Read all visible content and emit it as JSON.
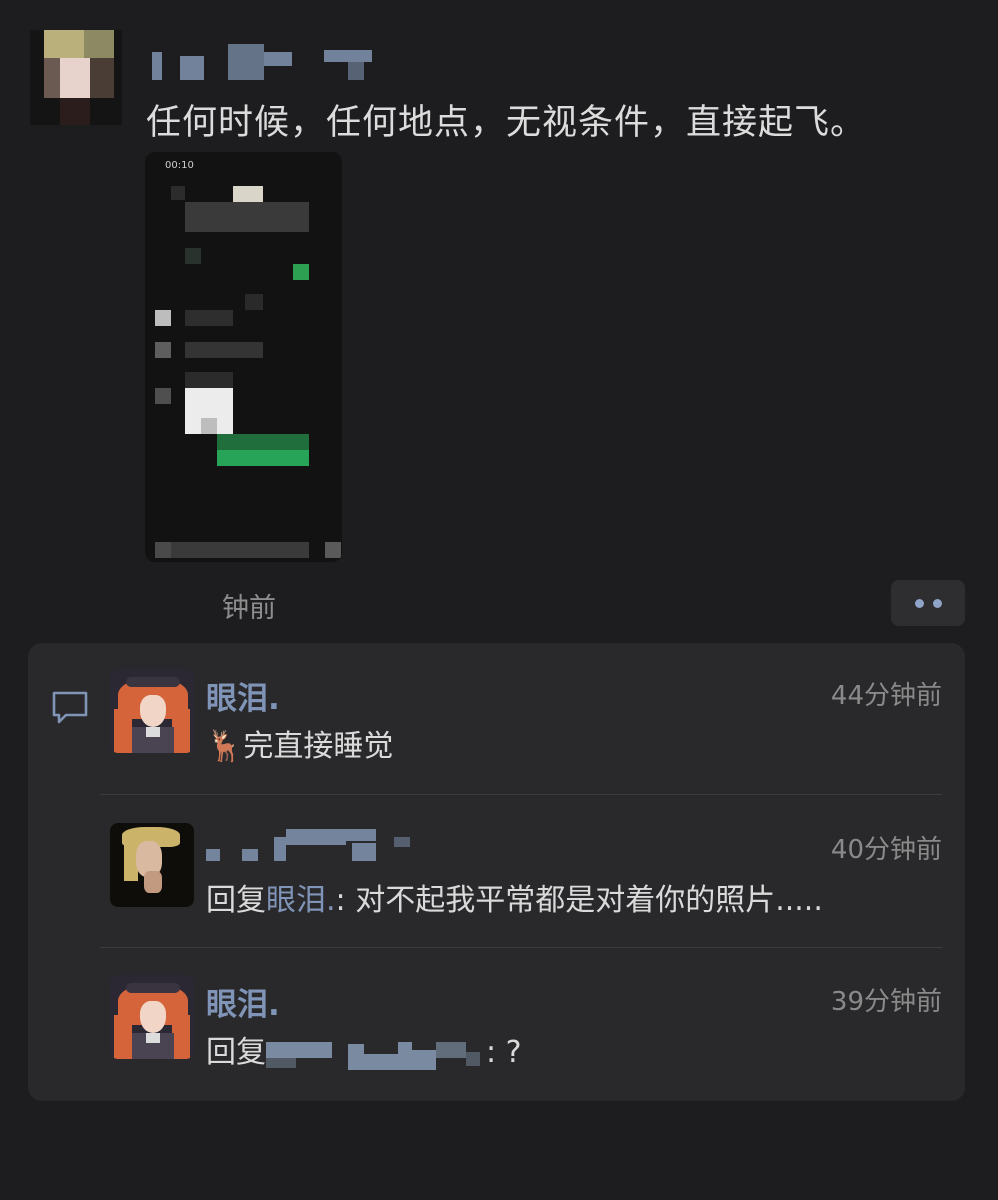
{
  "post": {
    "text": "任何时候，任何地点，无视条件，直接起飞。",
    "image_status_time": "00:10",
    "time_ago": "钟前"
  },
  "comments": [
    {
      "name": "眼泪.",
      "time": "44分钟前",
      "emoji": "🦌",
      "text": "完直接睡觉"
    },
    {
      "time": "40分钟前",
      "reply_prefix": "回复",
      "reply_to": "眼泪.",
      "text": ": 对不起我平常都是对着你的照片....."
    },
    {
      "name": "眼泪.",
      "time": "39分钟前",
      "reply_prefix": "回复",
      "text": ": ?"
    }
  ],
  "icons": {
    "comment": "comment-bubble-icon",
    "more": "more-dots-icon"
  },
  "colors": {
    "background": "#1d1d1f",
    "panel": "#29292b",
    "name_link": "#7f94b6",
    "time": "#8a8a8a"
  }
}
